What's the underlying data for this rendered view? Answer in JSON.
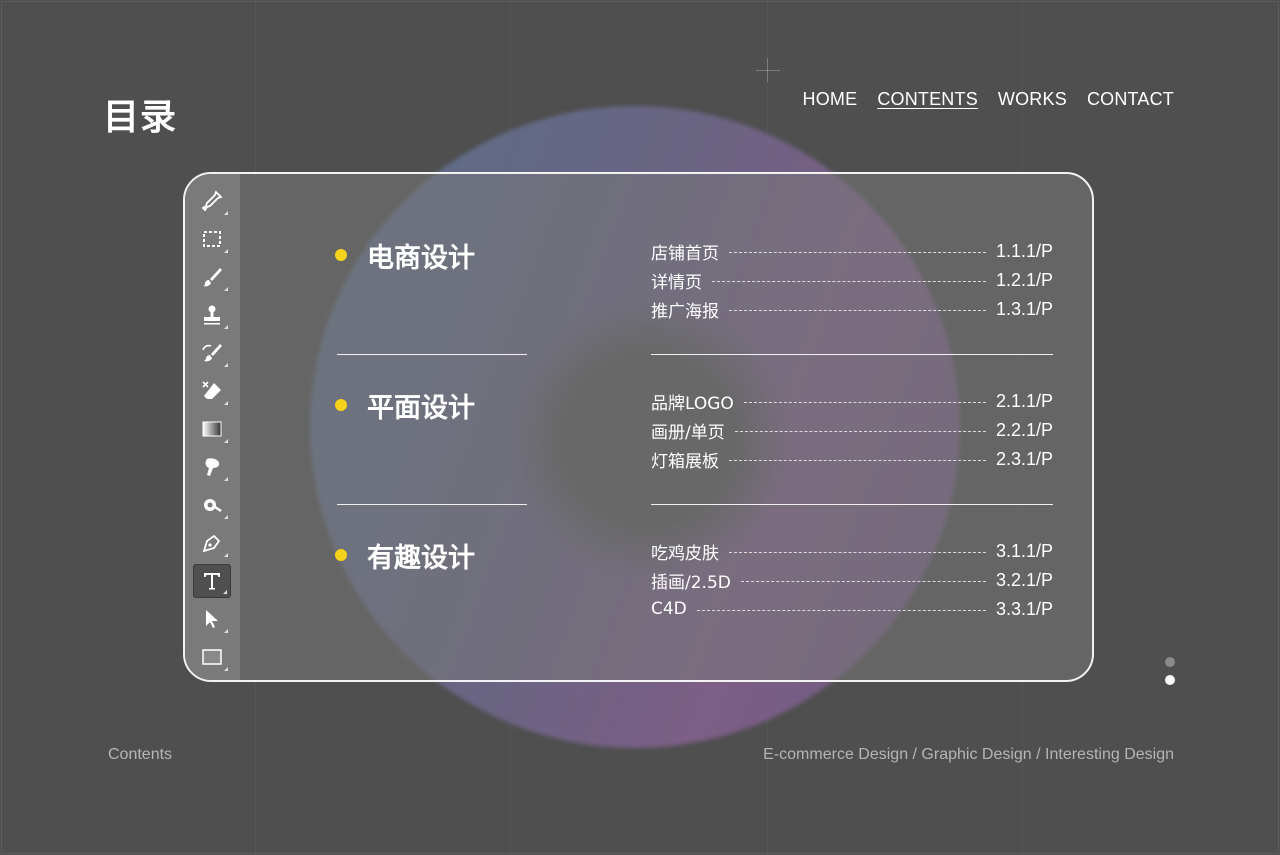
{
  "header": {
    "title": "目录",
    "nav": [
      {
        "label": "HOME",
        "active": false
      },
      {
        "label": "CONTENTS",
        "active": true
      },
      {
        "label": "WORKS",
        "active": false
      },
      {
        "label": "CONTACT",
        "active": false
      }
    ]
  },
  "toolbar": {
    "tools": [
      "eyedropper-icon",
      "marquee-icon",
      "brush-icon",
      "stamp-icon",
      "history-brush-icon",
      "eraser-icon",
      "gradient-icon",
      "smudge-icon",
      "dodge-icon",
      "pen-icon",
      "type-icon",
      "pointer-icon",
      "rectangle-icon"
    ],
    "active_tool": "type-icon"
  },
  "sections": [
    {
      "title": "电商设计",
      "items": [
        {
          "label": "店铺首页",
          "page": "1.1.1/P"
        },
        {
          "label": "详情页",
          "page": "1.2.1/P"
        },
        {
          "label": "推广海报",
          "page": "1.3.1/P"
        }
      ]
    },
    {
      "title": "平面设计",
      "items": [
        {
          "label": "品牌LOGO",
          "page": "2.1.1/P"
        },
        {
          "label": "画册/单页",
          "page": "2.2.1/P"
        },
        {
          "label": "灯箱展板",
          "page": "2.3.1/P"
        }
      ]
    },
    {
      "title": "有趣设计",
      "items": [
        {
          "label": "吃鸡皮肤",
          "page": "3.1.1/P"
        },
        {
          "label": "插画/2.5D",
          "page": "3.2.1/P"
        },
        {
          "label": "C4D",
          "page": "3.3.1/P"
        }
      ]
    }
  ],
  "footer": {
    "left": "Contents",
    "right": "E-commerce Design / Graphic Design / Interesting Design"
  },
  "colors": {
    "background": "#4f4f4f",
    "bullet": "#f5d31b",
    "card_border": "#f2f2f2"
  },
  "pager": {
    "total": 2,
    "current": 2
  }
}
